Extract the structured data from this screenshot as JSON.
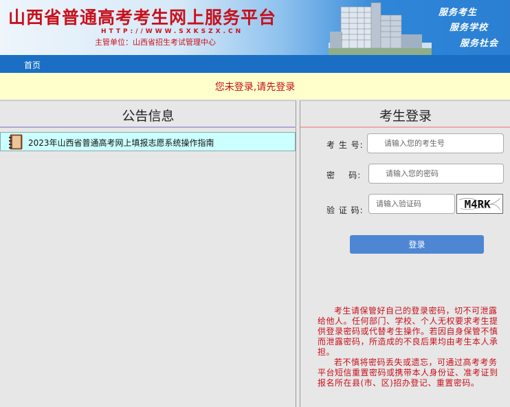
{
  "header": {
    "title": "山西省普通高考考生网上服务平台",
    "url": "HTTP://WWW.SXKSZX.CN",
    "sponsor": "主管单位：山西省招生考试管理中心",
    "slogans": [
      "服务考生",
      "服务学校",
      "服务社会"
    ]
  },
  "nav": {
    "items": [
      {
        "label": "首页"
      }
    ]
  },
  "login_notice": "您未登录,请先登录",
  "announcements": {
    "title": "公告信息",
    "items": [
      {
        "label": "2023年山西省普通高考网上填报志愿系统操作指南",
        "icon": "book-icon"
      }
    ]
  },
  "login": {
    "title": "考生登录",
    "exam_no": {
      "label": "考 生 号:",
      "placeholder": "请输入您的考生号",
      "value": ""
    },
    "password": {
      "label": "密    码:",
      "placeholder": "请输入您的密码",
      "value": ""
    },
    "captcha": {
      "label": "验 证 码:",
      "placeholder": "请输入验证码",
      "value": "",
      "image_text": "M4RK"
    },
    "submit_label": "登录"
  },
  "notice": {
    "paragraphs": [
      "考生请保管好自己的登录密码，切不可泄露给他人。任何部门、学校、个人无权要求考生提供登录密码或代替考生操作。若因自身保管不慎而泄露密码，所造成的不良后果均由考生本人承担。",
      "若不慎将密码丢失或遗忘，可通过高考考务平台短信重置密码或携带本人身份证、准考证到报名所在县(市、区)招办登记、重置密码。"
    ]
  },
  "colors": {
    "brand_red": "#c8101b",
    "nav_blue": "#1a6fc4",
    "button_blue": "#4e86d4",
    "notice_bg": "#ffffcc"
  }
}
